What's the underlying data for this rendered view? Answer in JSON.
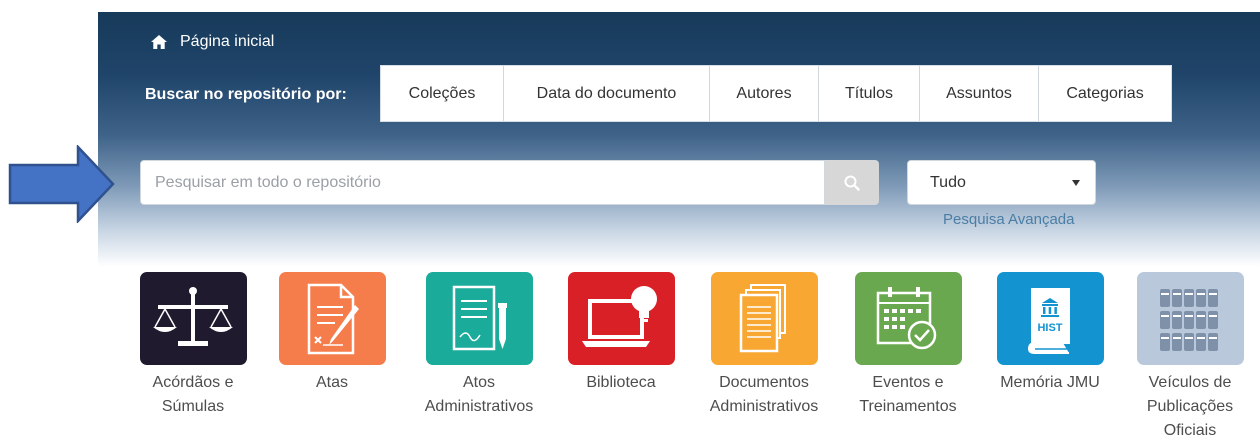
{
  "header": {
    "home_label": "Página inicial",
    "browse_label": "Buscar no repositório por:",
    "browse_options": [
      "Coleções",
      "Data do documento",
      "Autores",
      "Títulos",
      "Assuntos",
      "Categorias"
    ]
  },
  "search": {
    "placeholder": "Pesquisar em todo o repositório",
    "value": "",
    "scope_selected": "Tudo",
    "advanced_link": "Pesquisa Avançada"
  },
  "categories": [
    {
      "label_line1": "Acórdãos e",
      "label_line2": "Súmulas",
      "color": "#1f1a2e",
      "icon": "scales-icon"
    },
    {
      "label_line1": "Atas",
      "label_line2": "",
      "color": "#f57c4b",
      "icon": "document-pen-icon"
    },
    {
      "label_line1": "Atos",
      "label_line2": "Administrativos",
      "color": "#1aab9b",
      "icon": "signed-document-icon"
    },
    {
      "label_line1": "Biblioteca",
      "label_line2": "",
      "color": "#d92027",
      "icon": "laptop-bulb-icon"
    },
    {
      "label_line1": "Documentos",
      "label_line2": "Administrativos",
      "color": "#f7a732",
      "icon": "stacked-documents-icon"
    },
    {
      "label_line1": "Eventos e",
      "label_line2": "Treinamentos",
      "color": "#6aa84f",
      "icon": "calendar-check-icon"
    },
    {
      "label_line1": "Memória JMU",
      "label_line2": "",
      "color": "#1493d1",
      "icon": "history-book-icon",
      "icon_text": "HIST"
    },
    {
      "label_line1": "Veículos de",
      "label_line2": "Publicações",
      "label_line3": "Oficiais",
      "color": "#b9c9db",
      "icon": "shelf-binders-icon"
    }
  ],
  "colors": {
    "header_dark": "#173a5a",
    "arrow_fill": "#4472c4",
    "arrow_stroke": "#2f528f",
    "link": "#4a7ea6"
  }
}
